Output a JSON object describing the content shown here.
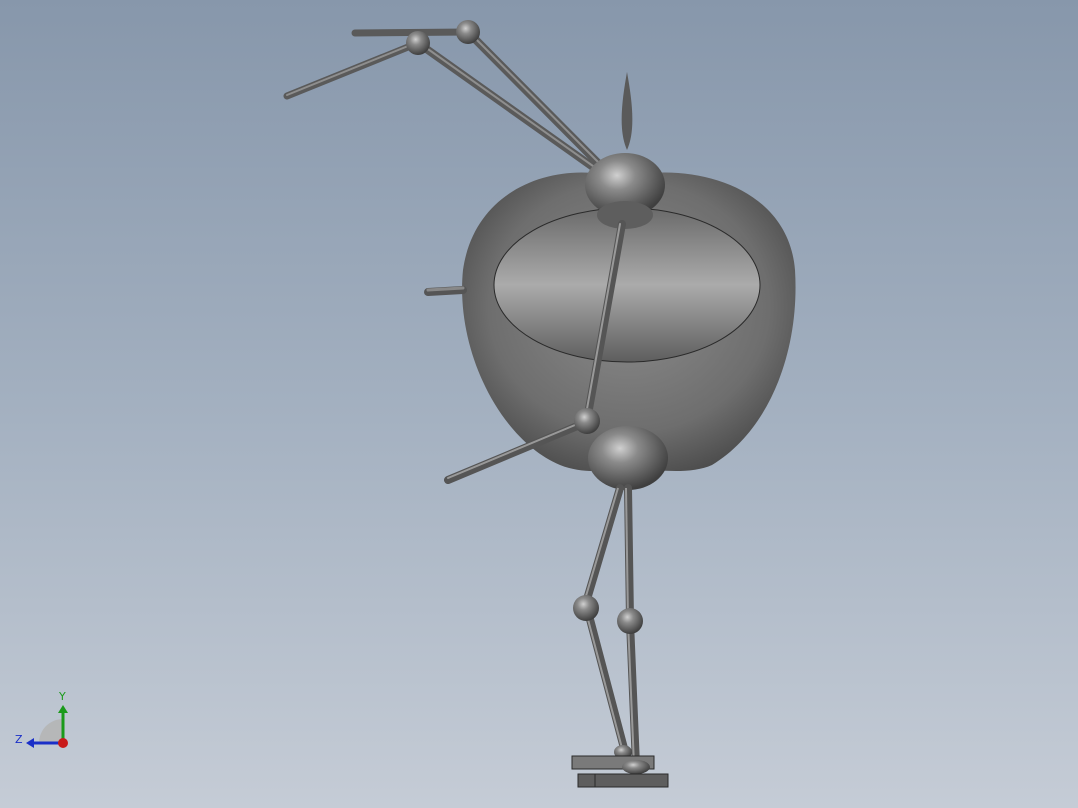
{
  "viewport": {
    "background_top": "#8797ab",
    "background_bottom": "#c5ccd6"
  },
  "model": {
    "description_icon": "apple-robot-model",
    "body_color": "#7a7a7a",
    "highlight_color": "#bdbdbd"
  },
  "triad": {
    "x_label": "",
    "y_label": "Y",
    "z_label": "Z",
    "y_color": "#1a9a1a",
    "z_color": "#1a2fc8",
    "x_color": "#c81a1a"
  }
}
